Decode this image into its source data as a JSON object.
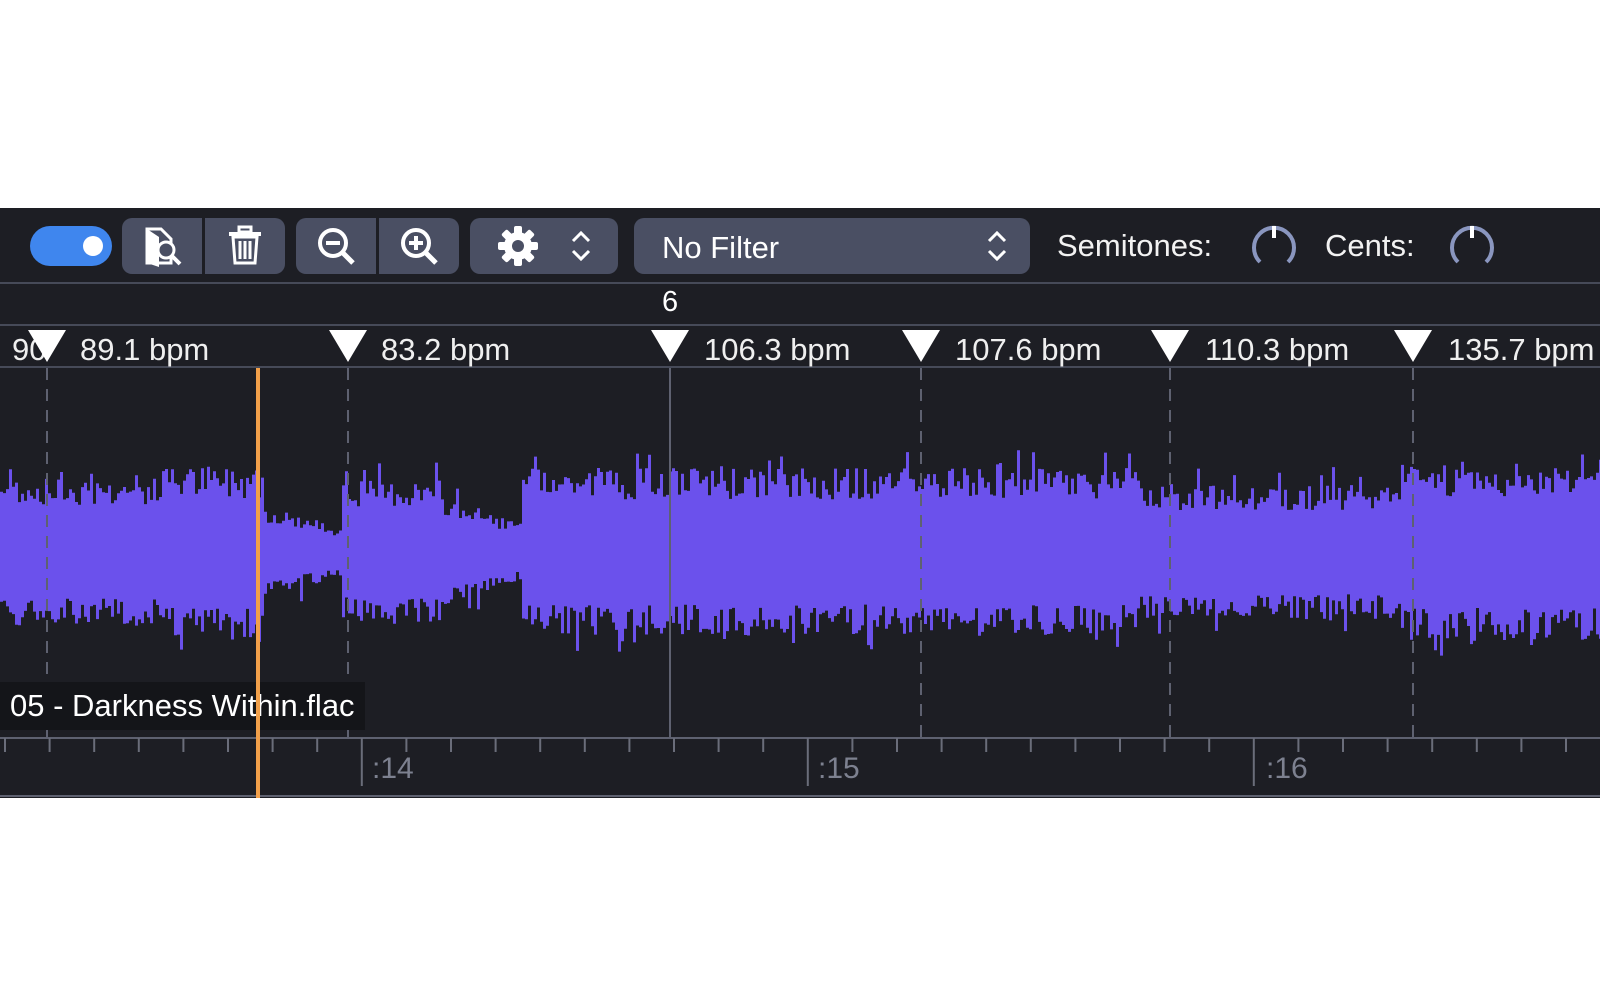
{
  "toolbar": {
    "toggle_on": true,
    "icons": {
      "find": "document-search-icon",
      "delete": "trash-icon",
      "zoom_out": "zoom-out-icon",
      "zoom_in": "zoom-in-icon",
      "settings": "gear-icon",
      "settings_stepper": "chevron-updown-icon",
      "filter_stepper": "chevron-updown-icon"
    },
    "filter_value": "No Filter",
    "semitones_label": "Semitones:",
    "cents_label": "Cents:"
  },
  "bar_number": "6",
  "tempo_markers": [
    {
      "label": "90"
    },
    {
      "label": "89.1 bpm"
    },
    {
      "label": "83.2 bpm"
    },
    {
      "label": "106.3 bpm"
    },
    {
      "label": "107.6 bpm"
    },
    {
      "label": "110.3 bpm"
    },
    {
      "label": "135.7 bpm"
    }
  ],
  "track": {
    "filename": "05 - Darkness Within.flac"
  },
  "timeline": {
    "labels": [
      ":14",
      ":15",
      ":16"
    ]
  },
  "colors": {
    "waveform": "#6b51ec",
    "playhead": "#f2a04a",
    "accent": "#3f86ee",
    "background": "#1d1e24"
  }
}
